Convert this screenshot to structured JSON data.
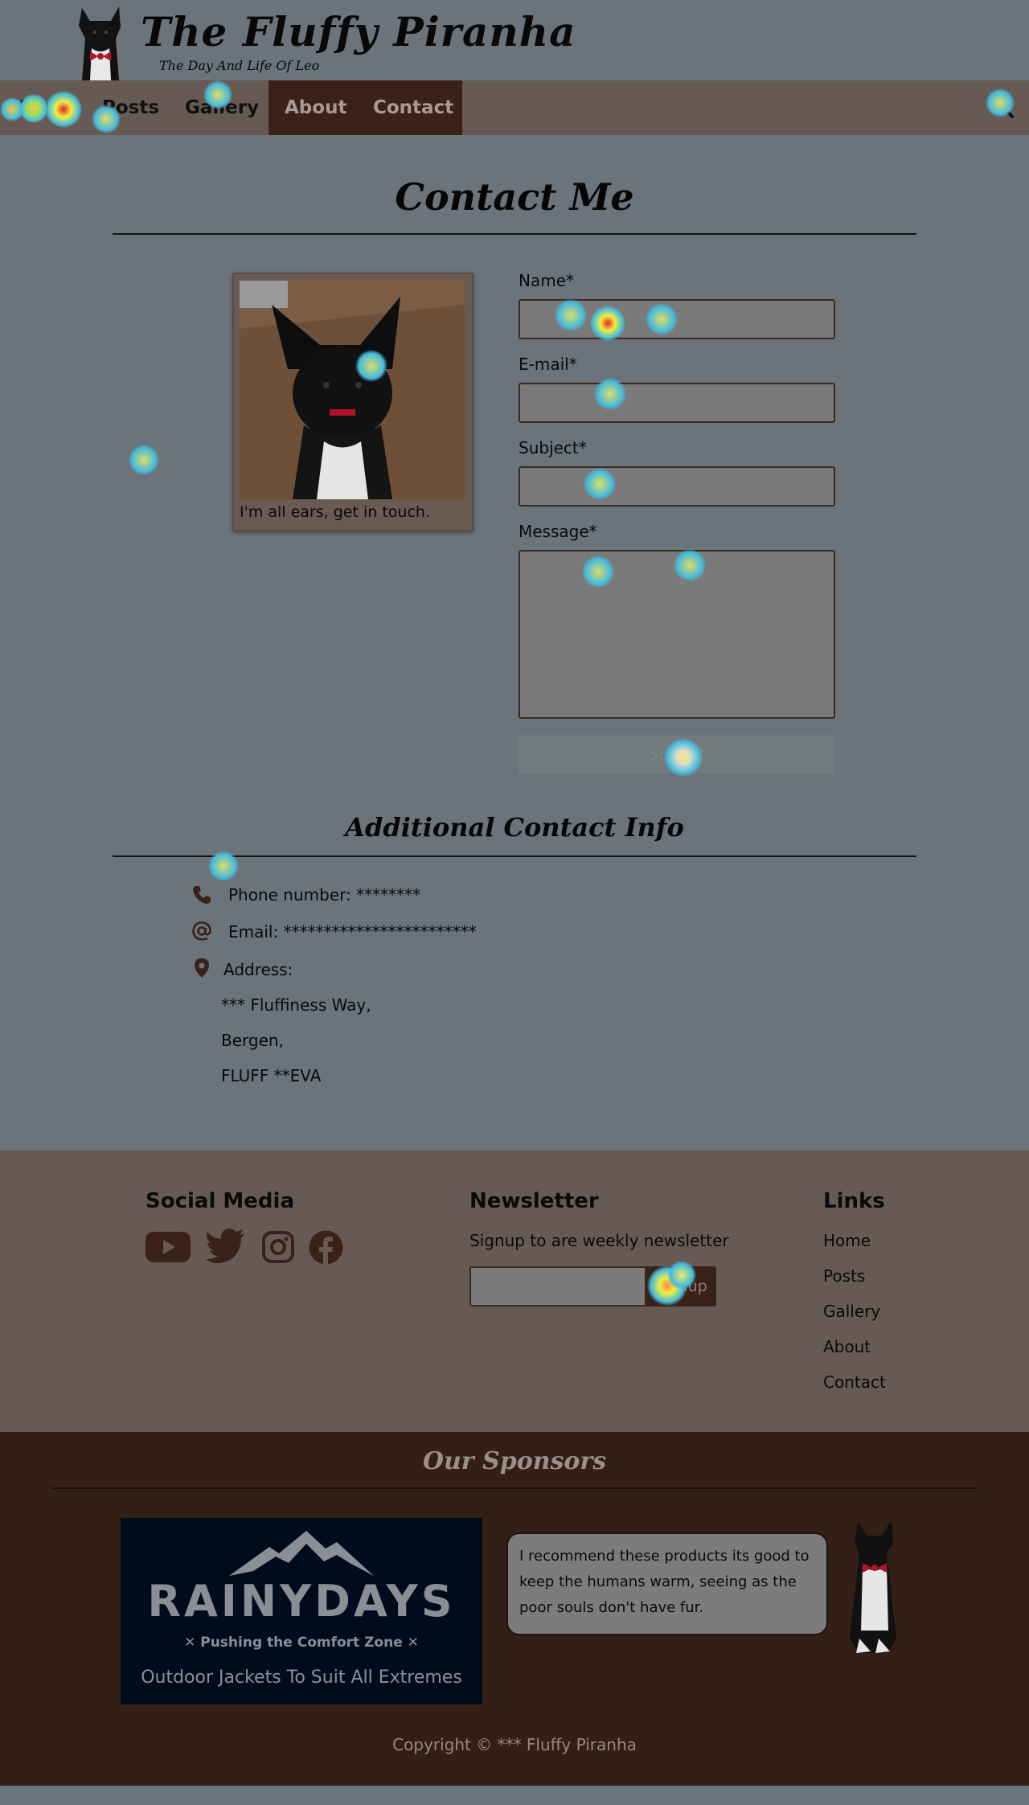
{
  "site": {
    "title": "The Fluffy Piranha",
    "tagline": "The Day And Life Of Leo"
  },
  "nav": {
    "items": [
      {
        "label": "Home"
      },
      {
        "label": "Posts"
      },
      {
        "label": "Gallery"
      },
      {
        "label": "About"
      },
      {
        "label": "Contact"
      }
    ],
    "search_icon": "search-icon"
  },
  "contact": {
    "title": "Contact Me",
    "photo_caption": "I'm all ears, get in touch.",
    "form": {
      "name_label": "Name*",
      "email_label": "E-mail*",
      "subject_label": "Subject*",
      "message_label": "Message*",
      "submit_label": "Submit"
    }
  },
  "additional": {
    "title": "Additional Contact Info",
    "phone": "Phone number: ********",
    "email": "Email: ************************",
    "address_label": "Address:",
    "address_lines": [
      "*** Fluffiness Way,",
      "Bergen,",
      "FLUFF **EVA"
    ]
  },
  "footer": {
    "social_title": "Social Media",
    "social_icons": [
      "youtube-icon",
      "twitter-icon",
      "instagram-icon",
      "facebook-icon"
    ],
    "newsletter_title": "Newsletter",
    "newsletter_text": "Signup to are weekly newsletter",
    "signup_label": "Signup",
    "links_title": "Links",
    "links": [
      "Home",
      "Posts",
      "Gallery",
      "About",
      "Contact"
    ]
  },
  "sponsors": {
    "title": "Our Sponsors",
    "brand": "RAINYDAYS",
    "slogan": "✕ Pushing the Comfort Zone ✕",
    "ad_text": "Outdoor Jackets To Suit All Extremes",
    "quote": "I recommend these products its good to keep the humans warm, seeing as the poor souls don't have fur.",
    "copyright": "Copyright © *** Fluffy Piranha"
  },
  "colors": {
    "page_bg": "#6a747a",
    "nav_bg": "#675954",
    "active_nav": "#3a2218",
    "sponsors_bg": "#341f14"
  }
}
